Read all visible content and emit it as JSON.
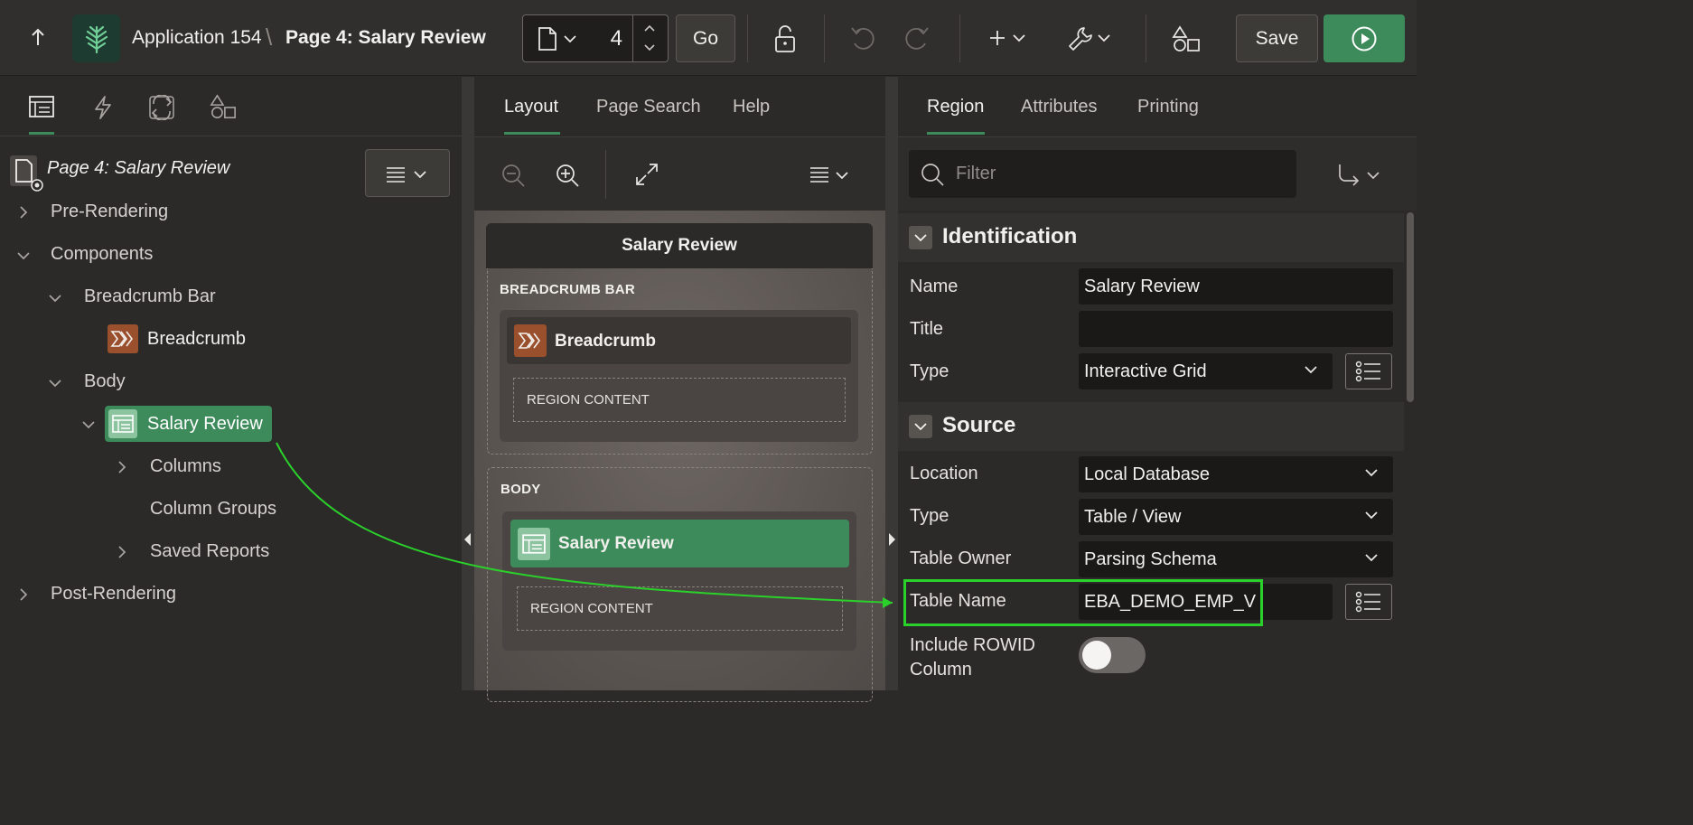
{
  "topbar": {
    "app_name": "Application 154",
    "separator": "\\",
    "page_name": "Page 4: Salary Review",
    "page_number": "4",
    "go_label": "Go",
    "save_label": "Save"
  },
  "left": {
    "header_label": "Page 4: Salary Review",
    "tree": {
      "pre_rendering": "Pre-Rendering",
      "components": "Components",
      "breadcrumb_bar": "Breadcrumb Bar",
      "breadcrumb": "Breadcrumb",
      "body": "Body",
      "salary_review": "Salary Review",
      "columns": "Columns",
      "column_groups": "Column Groups",
      "saved_reports": "Saved Reports",
      "post_rendering": "Post-Rendering"
    }
  },
  "middle": {
    "tabs": [
      "Layout",
      "Page Search",
      "Help"
    ],
    "page_header": "Salary Review",
    "breadcrumb_bar_label": "BREADCRUMB BAR",
    "breadcrumb_title": "Breadcrumb",
    "region_content_1": "REGION CONTENT",
    "body_label": "BODY",
    "salary_review_title": "Salary Review",
    "region_content_2": "REGION CONTENT"
  },
  "right": {
    "tabs": [
      "Region",
      "Attributes",
      "Printing"
    ],
    "filter_placeholder": "Filter",
    "identification": {
      "title": "Identification",
      "name_label": "Name",
      "name_value": "Salary Review",
      "title_label": "Title",
      "title_value": "",
      "type_label": "Type",
      "type_value": "Interactive Grid"
    },
    "source": {
      "title": "Source",
      "location_label": "Location",
      "location_value": "Local Database",
      "type_label": "Type",
      "type_value": "Table / View",
      "owner_label": "Table Owner",
      "owner_value": "Parsing Schema",
      "table_name_label": "Table Name",
      "table_name_value": "EBA_DEMO_EMP_V",
      "rowid_label_1": "Include ROWID",
      "rowid_label_2": "Column"
    }
  },
  "colors": {
    "accent_green": "#3d8b5b",
    "breadcrumb_brown": "#9a4f2d",
    "annotation_green": "#2bd12b"
  }
}
